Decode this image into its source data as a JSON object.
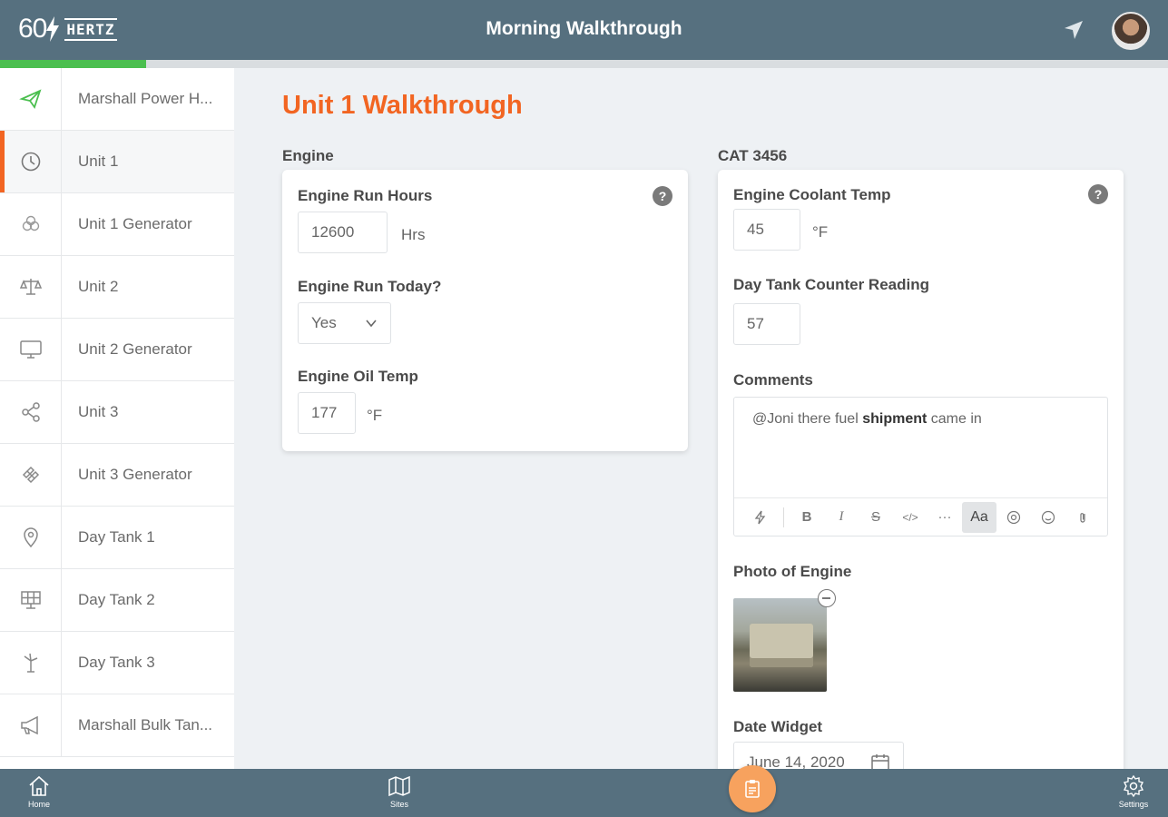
{
  "header": {
    "logo_number": "60",
    "logo_text": "HERTZ",
    "title": "Morning Walkthrough",
    "icons": {
      "navigate": "navigation-arrow-icon",
      "avatar": "user-avatar"
    }
  },
  "progress": {
    "fraction": 0.125,
    "color": "#4bbf4f"
  },
  "sidebar": {
    "items": [
      {
        "label": "Marshall Power H...",
        "icon": "paper-plane-icon"
      },
      {
        "label": "Unit 1",
        "icon": "clock-icon",
        "active": true
      },
      {
        "label": "Unit 1 Generator",
        "icon": "atom-icon"
      },
      {
        "label": "Unit 2",
        "icon": "scale-icon"
      },
      {
        "label": "Unit 2 Generator",
        "icon": "monitor-icon"
      },
      {
        "label": "Unit 3",
        "icon": "share-nodes-icon"
      },
      {
        "label": "Unit 3 Generator",
        "icon": "satellite-icon"
      },
      {
        "label": "Day Tank 1",
        "icon": "map-pin-icon"
      },
      {
        "label": "Day Tank 2",
        "icon": "solar-panel-icon"
      },
      {
        "label": "Day Tank 3",
        "icon": "wind-turbine-icon"
      },
      {
        "label": "Marshall Bulk Tan...",
        "icon": "megaphone-icon"
      }
    ]
  },
  "main": {
    "page_title": "Unit 1 Walkthrough",
    "left_section": {
      "label": "Engine",
      "help": "?",
      "fields": {
        "run_hours": {
          "label": "Engine Run Hours",
          "value": "12600",
          "unit": "Hrs"
        },
        "run_today": {
          "label": "Engine Run Today?",
          "value": "Yes"
        },
        "oil_temp": {
          "label": "Engine Oil Temp",
          "value": "177",
          "unit": "°F"
        }
      }
    },
    "right_section": {
      "label": "CAT 3456",
      "help": "?",
      "fields": {
        "coolant_temp": {
          "label": "Engine Coolant Temp",
          "value": "45",
          "unit": "°F"
        },
        "day_tank": {
          "label": "Day Tank Counter Reading",
          "value": "57"
        },
        "comments": {
          "label": "Comments",
          "text_before": "@Joni there fuel ",
          "text_bold": "shipment",
          "text_after": " came in",
          "toolbar": [
            "B",
            "I",
            "S",
            "</>",
            "···",
            "Aa"
          ]
        },
        "photo": {
          "label": "Photo of Engine"
        },
        "date": {
          "label": "Date Widget",
          "value": "June 14, 2020"
        }
      }
    }
  },
  "bottom_nav": {
    "home": "Home",
    "sites": "Sites",
    "settings": "Settings"
  },
  "colors": {
    "header": "#56707f",
    "accent": "#f26522",
    "fab": "#f7a25e"
  }
}
